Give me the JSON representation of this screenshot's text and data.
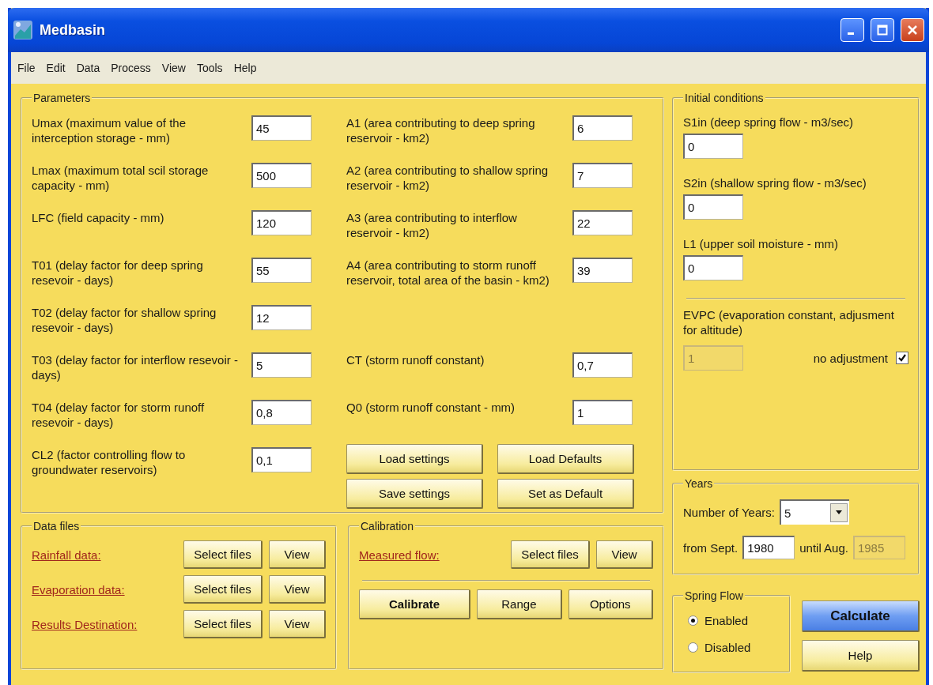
{
  "window": {
    "title": "Medbasin"
  },
  "menu": [
    "File",
    "Edit",
    "Data",
    "Process",
    "View",
    "Tools",
    "Help"
  ],
  "parameters": {
    "title": "Parameters",
    "left": [
      {
        "label": "Umax (maximum value of the interception storage - mm)",
        "value": "45"
      },
      {
        "label": "Lmax (maximum total scil storage capacity - mm)",
        "value": "500"
      },
      {
        "label": "LFC (field capacity - mm)",
        "value": "120"
      },
      {
        "label": "T01 (delay factor for deep spring resevoir - days)",
        "value": "55"
      },
      {
        "label": "T02 (delay factor for shallow spring resevoir - days)",
        "value": "12"
      },
      {
        "label": "T03 (delay factor for interflow resevoir - days)",
        "value": "5"
      },
      {
        "label": "T04 (delay factor for storm runoff resevoir - days)",
        "value": "0,8"
      },
      {
        "label": "CL2  (factor controlling flow to groundwater reservoirs)",
        "value": "0,1"
      }
    ],
    "right": [
      {
        "label": "A1 (area contributing to deep spring reservoir - km2)",
        "value": "6"
      },
      {
        "label": "A2 (area contributing to shallow spring reservoir - km2)",
        "value": "7"
      },
      {
        "label": "A3 (area contributing to interflow reservoir - km2)",
        "value": "22"
      },
      {
        "label": "A4 (area contributing to storm runoff reservoir, total area of the basin - km2)",
        "value": "39"
      },
      {
        "label": "CT (storm runoff constant)",
        "value": "0,7"
      },
      {
        "label": "Q0 (storm runoff constant - mm)",
        "value": "1"
      }
    ],
    "buttons": [
      "Load settings",
      "Load Defaults",
      "Save settings",
      "Set as Default"
    ]
  },
  "initial_conditions": {
    "title": "Initial conditions",
    "fields": [
      {
        "label": "S1in (deep spring flow - m3/sec)",
        "value": "0"
      },
      {
        "label": "S2in (shallow spring flow - m3/sec)",
        "value": "0"
      },
      {
        "label": "L1 (upper soil moisture - mm)",
        "value": "0"
      }
    ],
    "evpc": {
      "label": "EVPC (evaporation constant, adjusment for altitude)",
      "value": "1",
      "disabled": true,
      "checkbox_label": "no adjustment",
      "checked": true
    }
  },
  "years": {
    "title": "Years",
    "count_label": "Number of Years:",
    "count": "5",
    "from_label": "from Sept.",
    "from": "1980",
    "until_label": "until Aug.",
    "until": "1985",
    "until_disabled": true
  },
  "data_files": {
    "title": "Data files",
    "rows": [
      {
        "label": "Rainfall data:",
        "buttons": [
          "Select files",
          "View"
        ]
      },
      {
        "label": "Evaporation data:",
        "buttons": [
          "Select files",
          "View"
        ]
      },
      {
        "label": "Results Destination:",
        "buttons": [
          "Select files",
          "View"
        ]
      }
    ]
  },
  "calibration": {
    "title": "Calibration",
    "rows": [
      {
        "label": "Measured flow:",
        "buttons": [
          "Select files",
          "View"
        ]
      }
    ],
    "buttons": [
      {
        "label": "Calibrate",
        "bold": true
      },
      {
        "label": "Range",
        "bold": false
      },
      {
        "label": "Options",
        "bold": false
      }
    ]
  },
  "spring_flow": {
    "title": "Spring Flow",
    "options": [
      {
        "label": "Enabled",
        "selected": true
      },
      {
        "label": "Disabled",
        "selected": false
      }
    ]
  },
  "actions": [
    {
      "label": "Calculate",
      "kind": "primary"
    },
    {
      "label": "Help",
      "kind": "normal"
    }
  ]
}
